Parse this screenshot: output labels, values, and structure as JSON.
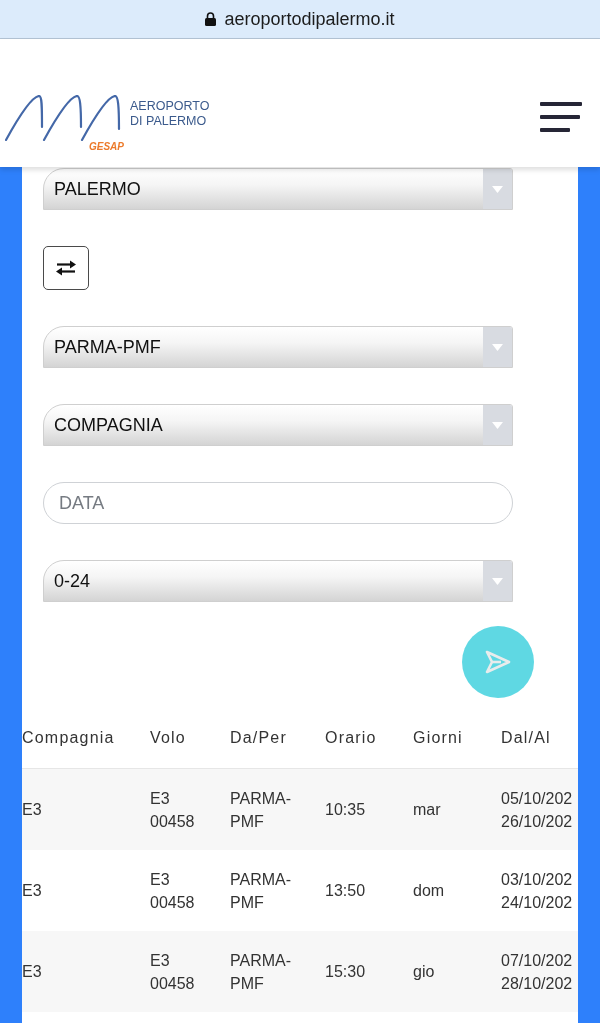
{
  "browser": {
    "url": "aeroportodipalermo.it"
  },
  "header": {
    "logo": {
      "name_lines": [
        "AEROPORTO",
        "DI PALERMO"
      ],
      "brand": "GESAP"
    }
  },
  "form": {
    "fields": [
      {
        "kind": "select",
        "value": "PALERMO"
      },
      {
        "kind": "swap-button"
      },
      {
        "kind": "select",
        "value": "PARMA-PMF"
      },
      {
        "kind": "select",
        "value": "COMPAGNIA"
      },
      {
        "kind": "date-input",
        "placeholder": "DATA"
      },
      {
        "kind": "select",
        "value": "0-24"
      }
    ]
  },
  "table": {
    "columns": [
      "Compagnia",
      "Volo",
      "Da/Per",
      "Orario",
      "Giorni",
      "Dal/Al"
    ],
    "rows": [
      {
        "compagnia": "E3",
        "volo": "E3 00458",
        "da_per": "PARMA-PMF",
        "orario": "10:35",
        "giorni": "mar",
        "dal_al": [
          "05/10/202",
          "26/10/202"
        ]
      },
      {
        "compagnia": "E3",
        "volo": "E3 00458",
        "da_per": "PARMA-PMF",
        "orario": "13:50",
        "giorni": "dom",
        "dal_al": [
          "03/10/202",
          "24/10/202"
        ]
      },
      {
        "compagnia": "E3",
        "volo": "E3 00458",
        "da_per": "PARMA-PMF",
        "orario": "15:30",
        "giorni": "gio",
        "dal_al": [
          "07/10/202",
          "28/10/202"
        ]
      }
    ]
  }
}
